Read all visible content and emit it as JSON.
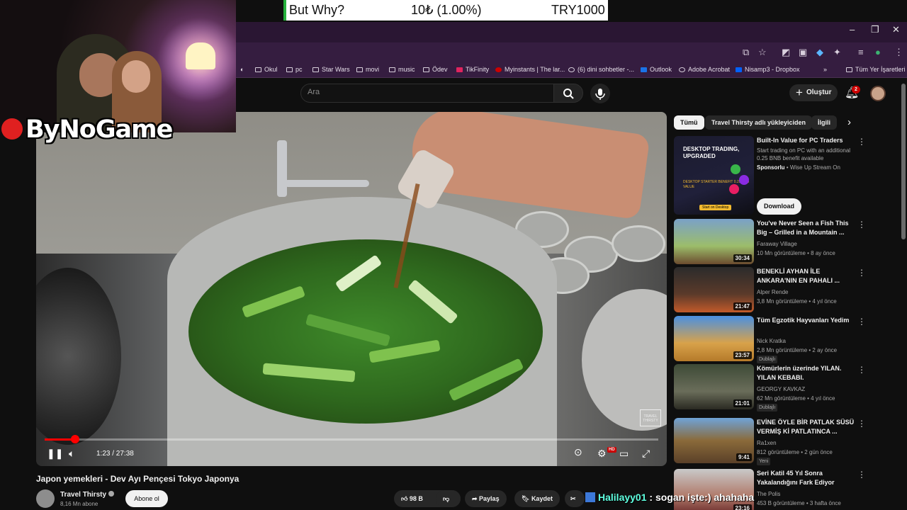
{
  "ticker": {
    "symbol": "But Why?",
    "change": "10₺ (1.00%)",
    "value": "TRY1000"
  },
  "stream": {
    "logo_text": "ByNoGame"
  },
  "browser": {
    "bookmarks": [
      "Okul",
      "pc",
      "Star Wars",
      "movi",
      "music",
      "Ödev",
      "TikFinity",
      "Myinstants | The lar...",
      "(6) dini sohbetler -...",
      "Outlook",
      "Adobe Acrobat",
      "Nisamp3 - Dropbox"
    ],
    "all_bookmarks": "Tüm Yer İşaretleri",
    "more": "»"
  },
  "header": {
    "search_placeholder": "Ara",
    "create_label": "Oluştur",
    "notif_count": "2"
  },
  "player": {
    "time": "1:23 / 27:38",
    "progress": 0.05,
    "watermark": "TRAVEL THIRSTY",
    "hd": "HD"
  },
  "video": {
    "title": "Japon yemekleri - Dev Ayı Pençesi Tokyo Japonya",
    "channel": "Travel Thirsty",
    "subs": "8,16 Mn abone",
    "subscribe": "Abone ol",
    "likes": "98 B",
    "share": "Paylaş",
    "save": "Kaydet"
  },
  "chat": {
    "user": "Halilayy01",
    "message": ": sogan işte:) ahahaha"
  },
  "sidebar": {
    "chips": [
      "Tümü",
      "Travel Thirsty adlı yükleyiciden",
      "İlgili"
    ],
    "ad": {
      "title": "Built-In Value for PC Traders",
      "desc": "Start trading on PC with an additional 0.25 BNB benefit available",
      "sponsor": "Sponsorlu",
      "advertiser": "Wise Up Stream On",
      "thumb_title": "DESKTOP TRADING, UPGRADED",
      "thumb_sub": "DESKTOP STARTER BENEFIT 0.25 BNB VALUE",
      "thumb_cta": "Start on Desktop",
      "download": "Download"
    },
    "items": [
      {
        "title": "You've Never Seen a Fish This Big – Grilled in a Mountain ...",
        "channel": "Faraway Village",
        "meta": "10 Mn görüntüleme • 8 ay önce",
        "duration": "30:34",
        "badge": ""
      },
      {
        "title": "BENEKLİ AYHAN İLE ANKARA'NIN EN PAHALI ...",
        "channel": "Alper Rende",
        "meta": "3,8 Mn görüntüleme • 4 yıl önce",
        "duration": "21:47",
        "badge": ""
      },
      {
        "title": "Tüm Egzotik Hayvanları Yedim",
        "channel": "Nick Kratka",
        "meta": "2,8 Mn görüntüleme • 2 ay önce",
        "duration": "23:57",
        "badge": "Dublajlı"
      },
      {
        "title": "Kömürlerin üzerinde YILAN. YILAN KEBABI.",
        "channel": "GEORGY KAVKAZ",
        "meta": "62 Mn görüntüleme • 4 yıl önce",
        "duration": "21:01",
        "badge": "Dublajlı"
      },
      {
        "title": "EVİNE ÖYLE BİR PATLAK SÜSÜ VERMİŞ Kİ PATLATINCA ...",
        "channel": "Ra1xen",
        "meta": "812 görüntüleme • 2 gün önce",
        "duration": "9:41",
        "badge": "Yeni"
      },
      {
        "title": "Seri Katil 45 Yıl Sonra Yakalandığını Fark Ediyor",
        "channel": "The Polis",
        "meta": "453 B görüntüleme • 3 hafta önce",
        "duration": "23:16",
        "badge": ""
      }
    ]
  },
  "colors": {
    "accent": "#ff0000",
    "brand_red": "#e02020",
    "browser_frame": "#351d40",
    "chat_user": "#5fffe0"
  },
  "icons": [
    "minimize-icon",
    "maximize-icon",
    "close-icon",
    "search-icon",
    "mic-icon",
    "bell-icon",
    "play-pause-icon",
    "volume-icon",
    "settings-icon",
    "fullscreen-icon",
    "like-icon",
    "dislike-icon",
    "share-icon",
    "save-icon",
    "clip-icon",
    "more-icon",
    "chevron-right-icon"
  ]
}
